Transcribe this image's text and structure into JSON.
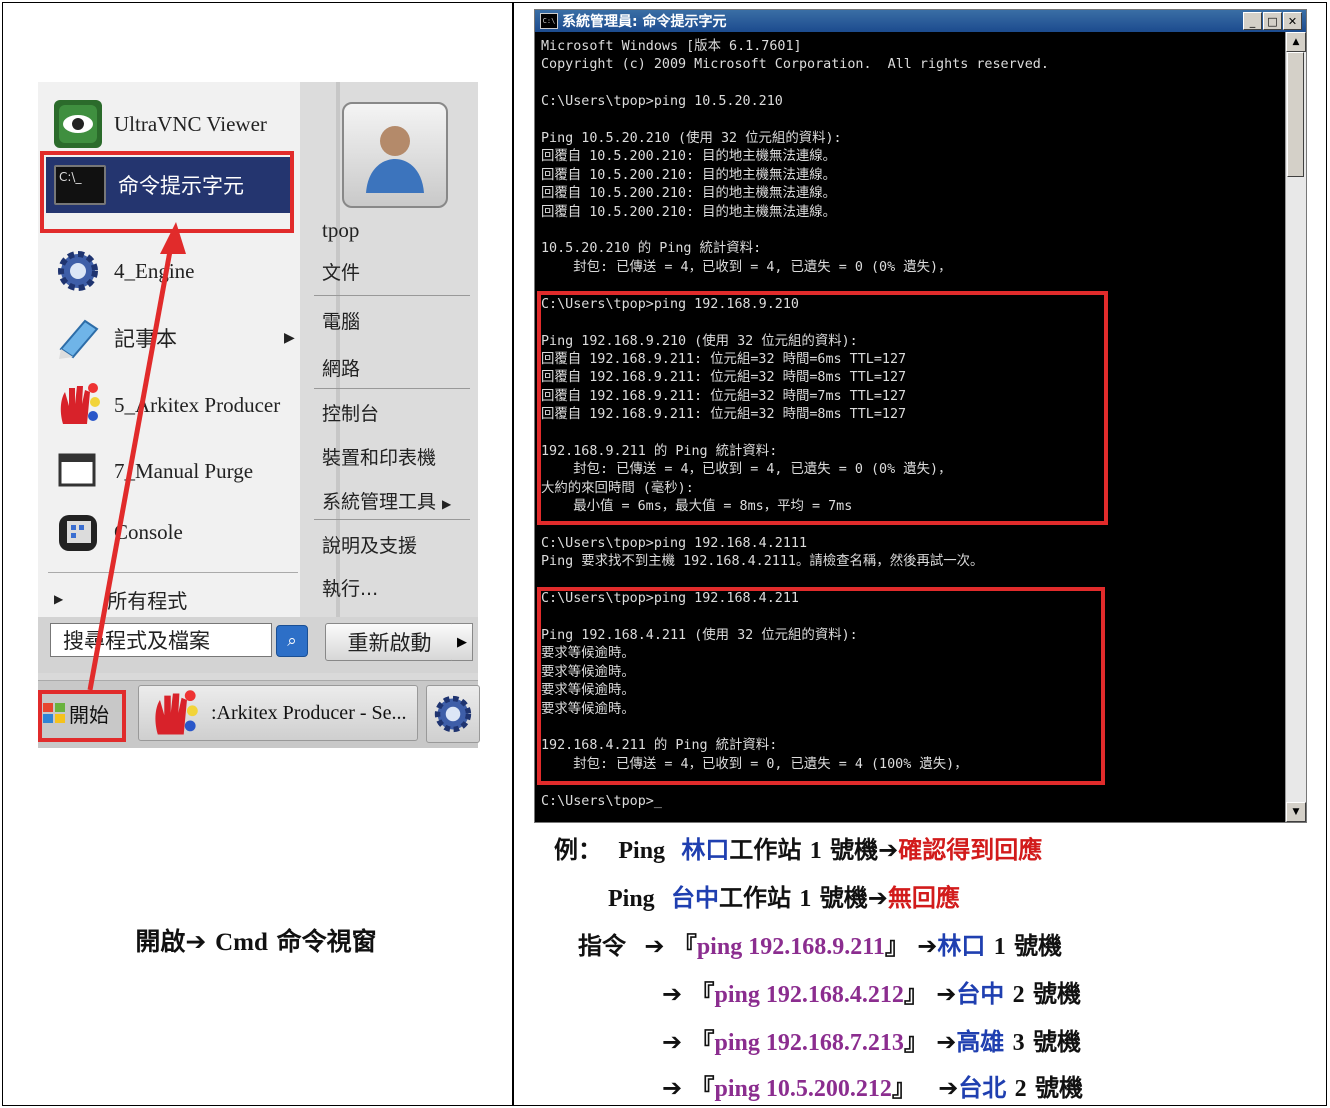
{
  "start_menu": {
    "programs": [
      {
        "label": "UltraVNC Viewer"
      },
      {
        "label": "命令提示字元"
      },
      {
        "label": "4_Engine"
      },
      {
        "label": "記事本"
      },
      {
        "label": "5_Arkitex Producer"
      },
      {
        "label": "7_Manual Purge"
      },
      {
        "label": "Console"
      }
    ],
    "all_programs": "所有程式",
    "user": "tpop",
    "links": [
      "文件",
      "電腦",
      "網路",
      "控制台",
      "裝置和印表機",
      "系統管理工具",
      "說明及支援",
      "執行..."
    ],
    "search_placeholder": "搜尋程式及檔案",
    "restart_label": "重新啟動"
  },
  "taskbar": {
    "start_label": "開始",
    "task_label": ":Arkitex Producer - Se..."
  },
  "left_caption": {
    "prefix": "開啟",
    "arrow": "➔",
    "en": "Cmd",
    "suffix": "命令視窗"
  },
  "cmd": {
    "title": "系統管理員: 命令提示字元",
    "icon_text": "C:\\",
    "output": "Microsoft Windows [版本 6.1.7601]\nCopyright (c) 2009 Microsoft Corporation.  All rights reserved.\n\nC:\\Users\\tpop>ping 10.5.20.210\n\nPing 10.5.20.210 (使用 32 位元組的資料):\n回覆自 10.5.200.210: 目的地主機無法連線。\n回覆自 10.5.200.210: 目的地主機無法連線。\n回覆自 10.5.200.210: 目的地主機無法連線。\n回覆自 10.5.200.210: 目的地主機無法連線。\n\n10.5.20.210 的 Ping 統計資料:\n    封包: 已傳送 = 4，已收到 = 4, 已遺失 = 0 (0% 遺失)，\n\nC:\\Users\\tpop>ping 192.168.9.210\n\nPing 192.168.9.210 (使用 32 位元組的資料):\n回覆自 192.168.9.211: 位元組=32 時間=6ms TTL=127\n回覆自 192.168.9.211: 位元組=32 時間=8ms TTL=127\n回覆自 192.168.9.211: 位元組=32 時間=7ms TTL=127\n回覆自 192.168.9.211: 位元組=32 時間=8ms TTL=127\n\n192.168.9.211 的 Ping 統計資料:\n    封包: 已傳送 = 4，已收到 = 4, 已遺失 = 0 (0% 遺失)，\n大約的來回時間 (毫秒):\n    最小值 = 6ms，最大值 = 8ms，平均 = 7ms\n\nC:\\Users\\tpop>ping 192.168.4.2111\nPing 要求找不到主機 192.168.4.2111。請檢查名稱，然後再試一次。\n\nC:\\Users\\tpop>ping 192.168.4.211\n\nPing 192.168.4.211 (使用 32 位元組的資料):\n要求等候逾時。\n要求等候逾時。\n要求等候逾時。\n要求等候逾時。\n\n192.168.4.211 的 Ping 統計資料:\n    封包: 已傳送 = 4，已收到 = 0, 已遺失 = 4 (100% 遺失)，\n\nC:\\Users\\tpop>_"
  },
  "notes": {
    "example_label": "例：",
    "ping_word": "Ping",
    "arrow": "➔",
    "line1": {
      "site": "林口",
      "mid": "工作站",
      "num": "1",
      "unit": "號機",
      "result": "確認得到回應"
    },
    "line2": {
      "site": "台中",
      "mid": "工作站",
      "num": "1",
      "unit": "號機",
      "result": "無回應"
    },
    "command_label": "指令",
    "commands": [
      {
        "cmd": "ping 192.168.9.211",
        "site": "林口",
        "num": "1",
        "unit": "號機"
      },
      {
        "cmd": "ping 192.168.4.212",
        "site": "台中",
        "num": "2",
        "unit": "號機"
      },
      {
        "cmd": "ping 192.168.7.213",
        "site": "高雄",
        "num": "3",
        "unit": "號機"
      },
      {
        "cmd": "ping 10.5.200.212",
        "site": "台北",
        "num": "2",
        "unit": "號機"
      }
    ],
    "quote_open": "『",
    "quote_close": "』"
  },
  "colors": {
    "highlight_red": "#e12b2b",
    "site_blue": "#1f3fb0",
    "result_red": "#d21b1b",
    "command_purple": "#8b2d8f"
  }
}
